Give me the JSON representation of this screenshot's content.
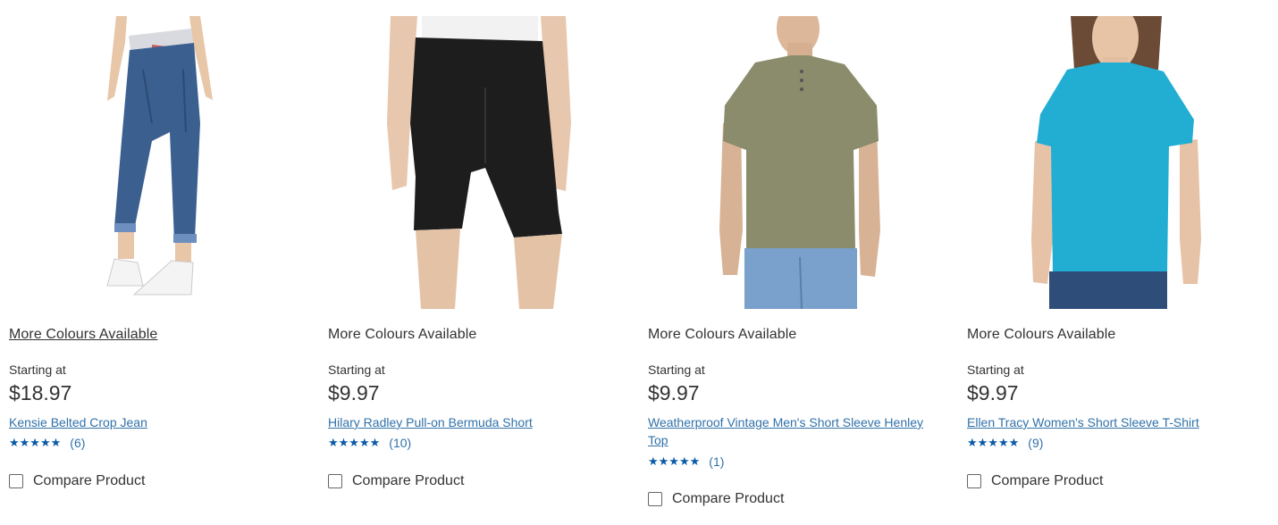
{
  "products": [
    {
      "more_colours": "More Colours Available",
      "starting_label": "Starting at",
      "price": "$18.97",
      "title": "Kensie Belted Crop Jean",
      "stars": "★★★★★",
      "rating_count": "(6)",
      "compare_label": "Compare Product",
      "image": "woman-cropped-jeans"
    },
    {
      "more_colours": "More Colours Available",
      "starting_label": "Starting at",
      "price": "$9.97",
      "title": "Hilary Radley Pull-on Bermuda Short",
      "stars": "★★★★★",
      "rating_count": "(10)",
      "compare_label": "Compare Product",
      "image": "black-bermuda-shorts"
    },
    {
      "more_colours": "More Colours Available",
      "starting_label": "Starting at",
      "price": "$9.97",
      "title": "Weatherproof Vintage Men's Short Sleeve Henley Top",
      "stars": "★★★★★",
      "rating_count": "(1)",
      "compare_label": "Compare Product",
      "image": "man-olive-henley"
    },
    {
      "more_colours": "More Colours Available",
      "starting_label": "Starting at",
      "price": "$9.97",
      "title": "Ellen Tracy Women's Short Sleeve T-Shirt",
      "stars": "★★★★★",
      "rating_count": "(9)",
      "compare_label": "Compare Product",
      "image": "woman-turquoise-tshirt"
    }
  ],
  "colors": {
    "link": "#3071a9",
    "star": "#0a5aa8",
    "text": "#333333"
  }
}
